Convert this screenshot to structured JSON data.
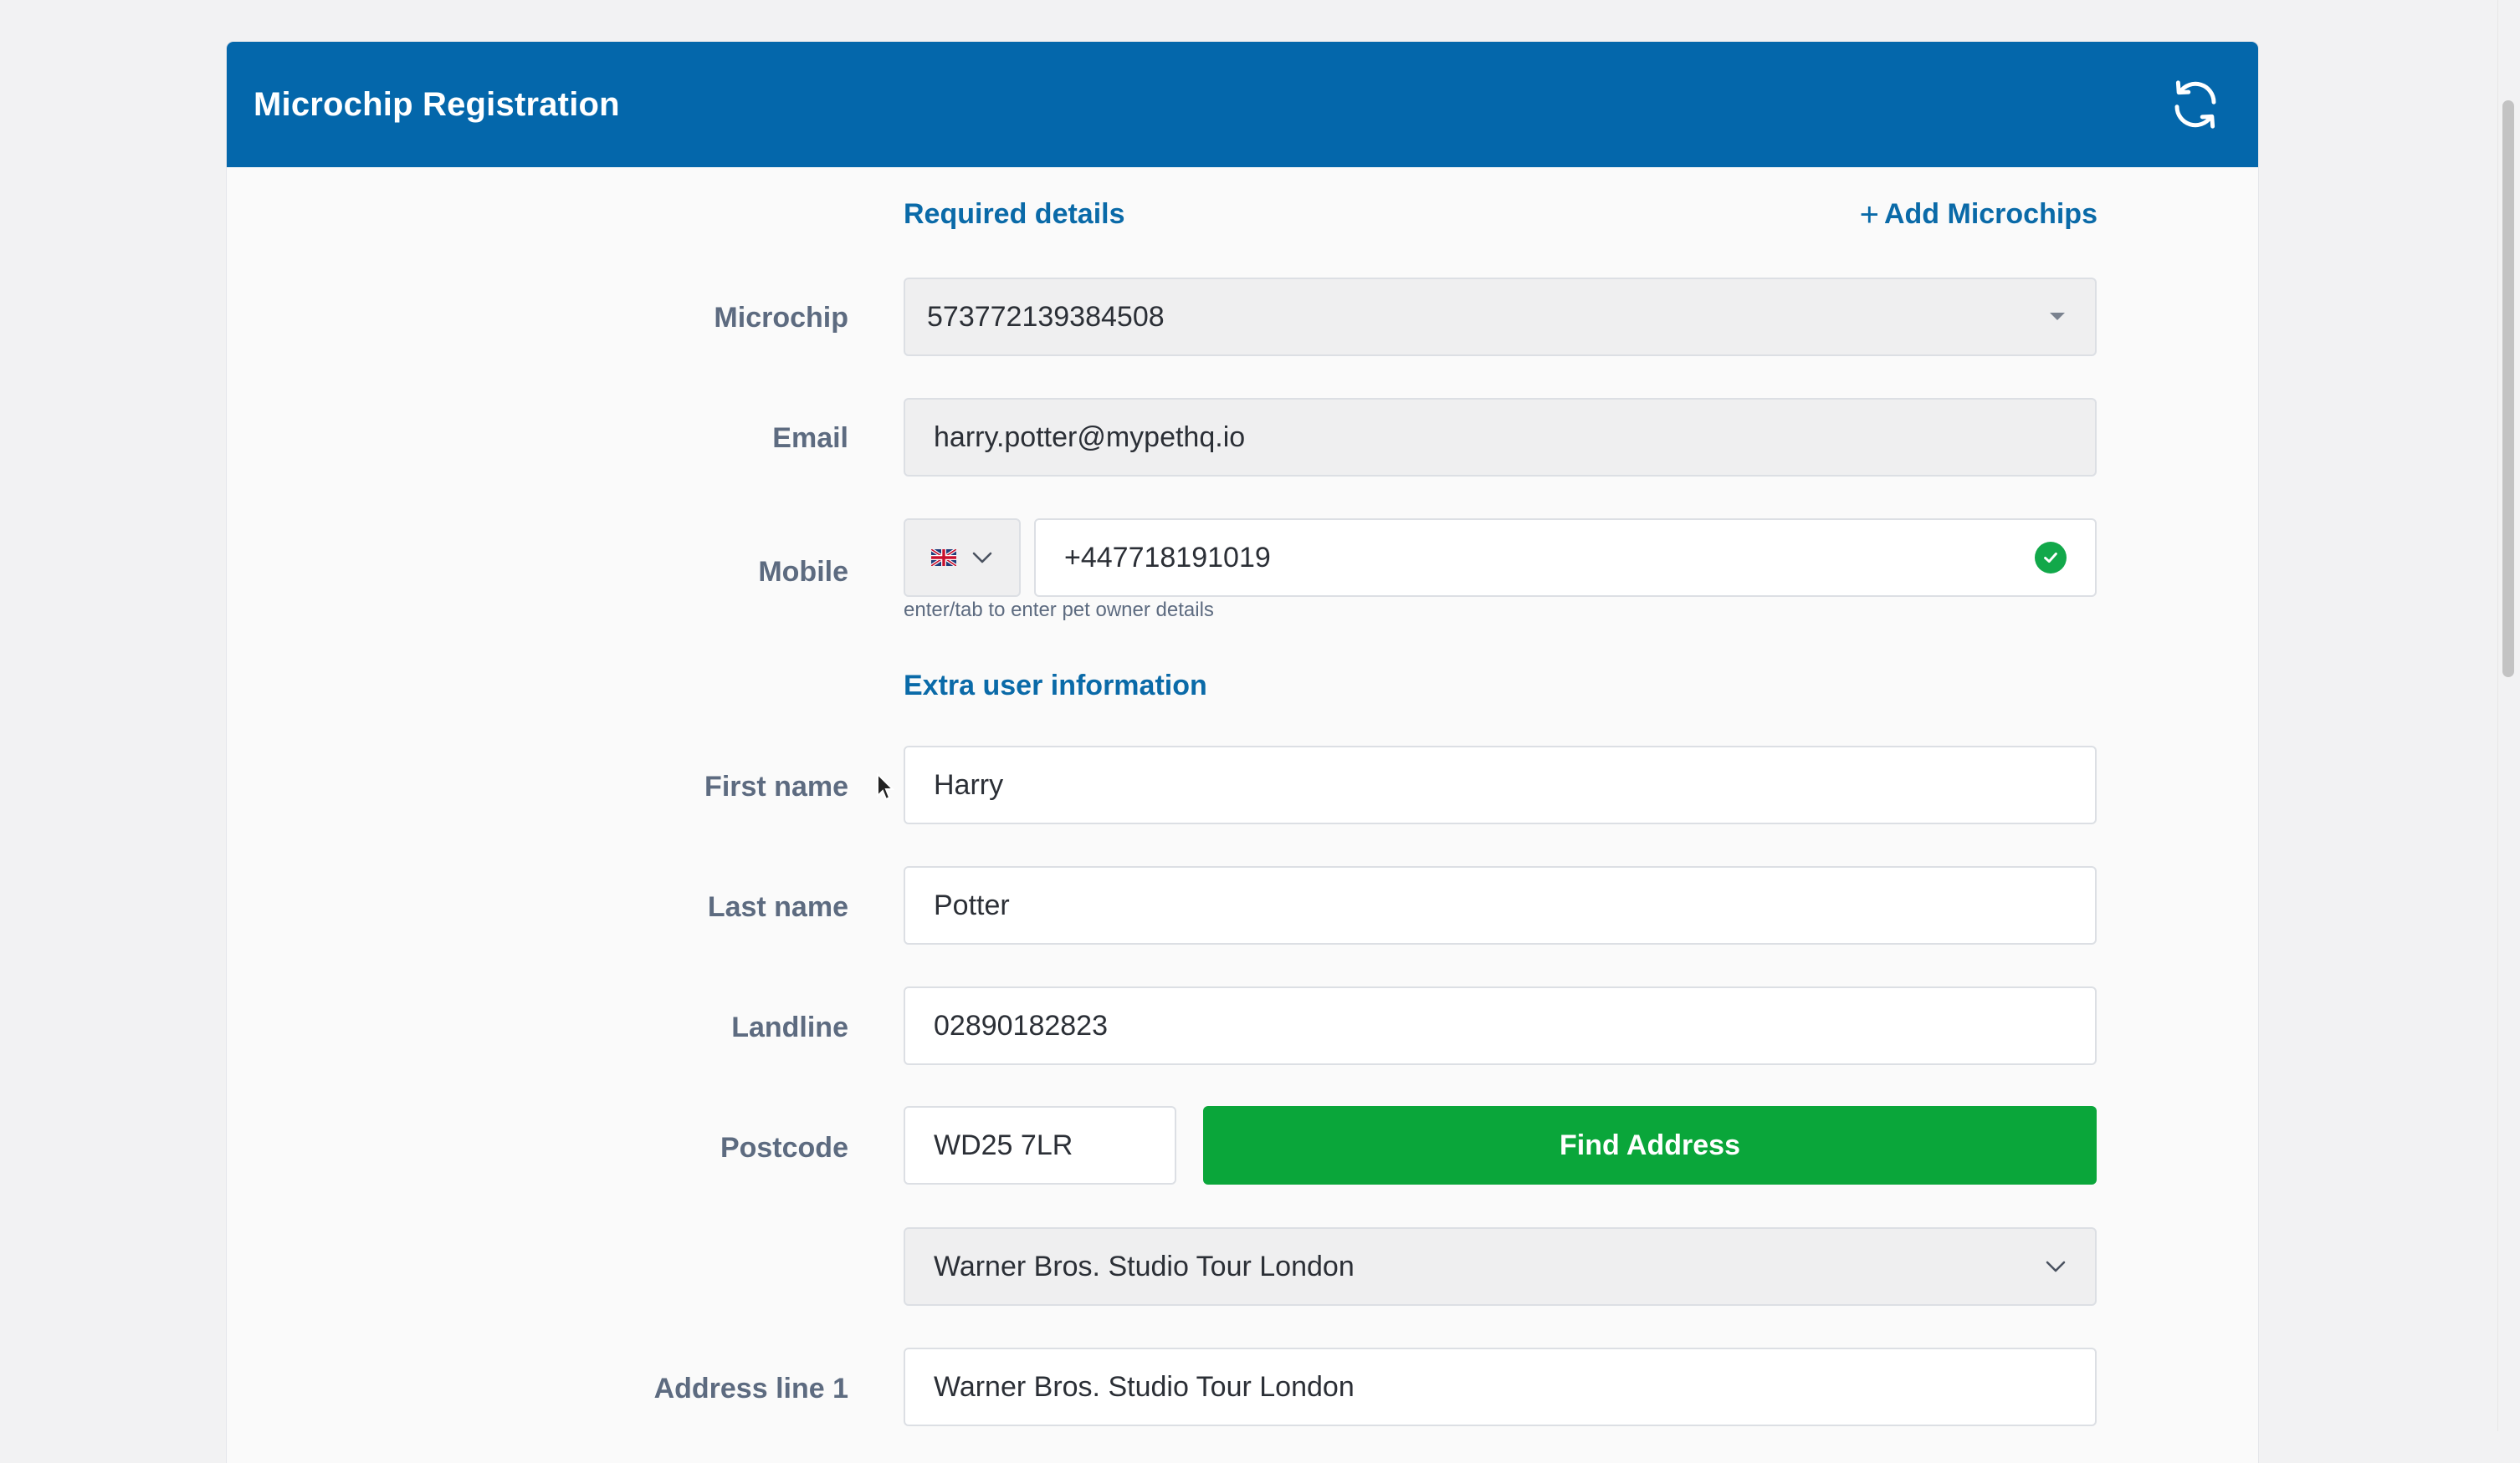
{
  "header": {
    "title": "Microchip Registration",
    "refresh_icon": "refresh-icon"
  },
  "required": {
    "section_title": "Required details",
    "add_microchips": "Add Microchips",
    "microchip": {
      "label": "Microchip",
      "value": "573772139384508"
    },
    "email": {
      "label": "Email",
      "value": "harry.potter@mypethq.io"
    },
    "mobile": {
      "label": "Mobile",
      "country_flag": "uk-flag-icon",
      "value": "+447718191019",
      "valid_icon": "check-circle-icon",
      "hint": "enter/tab to enter pet owner details"
    }
  },
  "extra": {
    "section_title": "Extra user information",
    "first_name": {
      "label": "First name",
      "value": "Harry"
    },
    "last_name": {
      "label": "Last name",
      "value": "Potter"
    },
    "landline": {
      "label": "Landline",
      "value": "02890182823"
    },
    "postcode": {
      "label": "Postcode",
      "value": "WD25 7LR",
      "button": "Find Address"
    },
    "address_select": {
      "value": "Warner Bros. Studio Tour London"
    },
    "address_line1": {
      "label": "Address line 1",
      "value": "Warner Bros. Studio Tour London"
    }
  },
  "colors": {
    "header": "#0467ab",
    "link": "#0a6aa8",
    "success": "#0aa63a"
  }
}
